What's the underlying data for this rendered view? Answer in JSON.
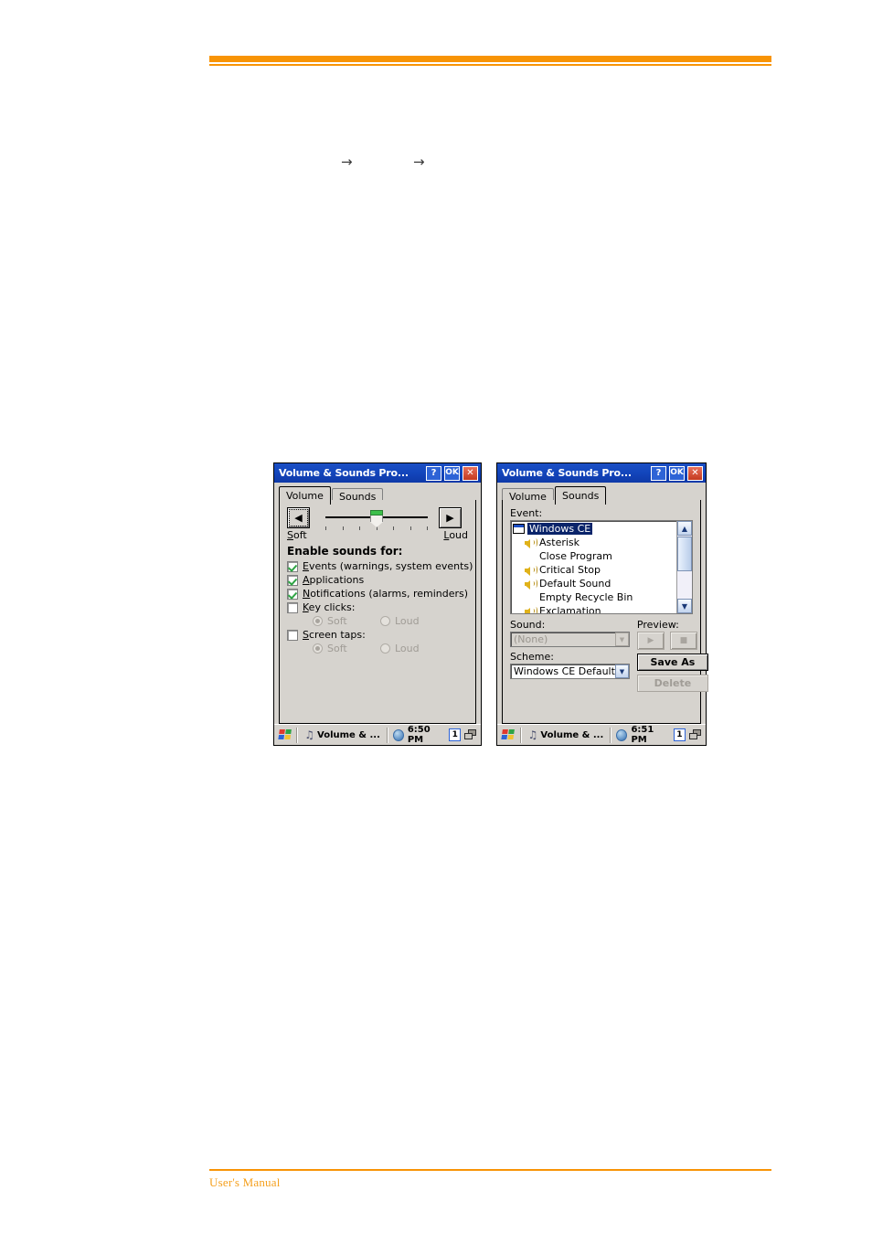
{
  "page": {
    "footer_text": "User's Manual",
    "arrow_glyph": "→",
    "accent_color": "#F89406"
  },
  "dialogs": [
    {
      "id": "volume-dialog",
      "title": "Volume & Sounds Pro...",
      "titlebar_buttons": {
        "help": "?",
        "ok": "OK",
        "close": "✕"
      },
      "tabs": [
        {
          "label": "Volume",
          "active": true
        },
        {
          "label": "Sounds",
          "active": false
        }
      ],
      "volume_tab": {
        "left_arrow": "◀",
        "right_arrow": "▶",
        "soft_label": "Soft",
        "loud_label": "Loud",
        "slider_position_percent": 50,
        "tick_count": 7,
        "section_title": "Enable sounds for:",
        "checkboxes": [
          {
            "label": "Events (warnings, system events)",
            "checked": true,
            "enabled": true
          },
          {
            "label": "Applications",
            "checked": true,
            "enabled": true
          },
          {
            "label": "Notifications (alarms, reminders)",
            "checked": true,
            "enabled": true
          },
          {
            "label": "Key clicks:",
            "checked": false,
            "enabled": true
          },
          {
            "label": "Screen taps:",
            "checked": false,
            "enabled": true
          }
        ],
        "key_clicks_radios": [
          {
            "label": "Soft",
            "selected": true,
            "enabled": false
          },
          {
            "label": "Loud",
            "selected": false,
            "enabled": false
          }
        ],
        "screen_taps_radios": [
          {
            "label": "Soft",
            "selected": true,
            "enabled": false
          },
          {
            "label": "Loud",
            "selected": false,
            "enabled": false
          }
        ]
      },
      "taskbar": {
        "task_label": "Volume & ...",
        "clock": "6:50 PM",
        "indicator": "1"
      }
    },
    {
      "id": "sounds-dialog",
      "title": "Volume & Sounds Pro...",
      "titlebar_buttons": {
        "help": "?",
        "ok": "OK",
        "close": "✕"
      },
      "tabs": [
        {
          "label": "Volume",
          "active": false
        },
        {
          "label": "Sounds",
          "active": true
        }
      ],
      "sounds_tab": {
        "event_label": "Event:",
        "event_tree": [
          {
            "label": "Windows CE",
            "level": 0,
            "icon": "window-icon",
            "selected": true
          },
          {
            "label": "Asterisk",
            "level": 1,
            "icon": "speaker-icon",
            "selected": false
          },
          {
            "label": "Close Program",
            "level": 1,
            "icon": "none",
            "selected": false
          },
          {
            "label": "Critical Stop",
            "level": 1,
            "icon": "speaker-icon",
            "selected": false
          },
          {
            "label": "Default Sound",
            "level": 1,
            "icon": "speaker-icon",
            "selected": false
          },
          {
            "label": "Empty Recycle Bin",
            "level": 1,
            "icon": "none",
            "selected": false
          },
          {
            "label": "Exclamation",
            "level": 1,
            "icon": "speaker-icon",
            "selected": false
          }
        ],
        "sound_label": "Sound:",
        "sound_value": "(None)",
        "sound_enabled": false,
        "scheme_label": "Scheme:",
        "scheme_value": "Windows CE Default",
        "preview_label": "Preview:",
        "play_glyph": "▶",
        "stop_glyph": "■",
        "save_as_label": "Save As",
        "delete_label": "Delete",
        "delete_enabled": false
      },
      "taskbar": {
        "task_label": "Volume & ...",
        "clock": "6:51 PM",
        "indicator": "1"
      }
    }
  ]
}
